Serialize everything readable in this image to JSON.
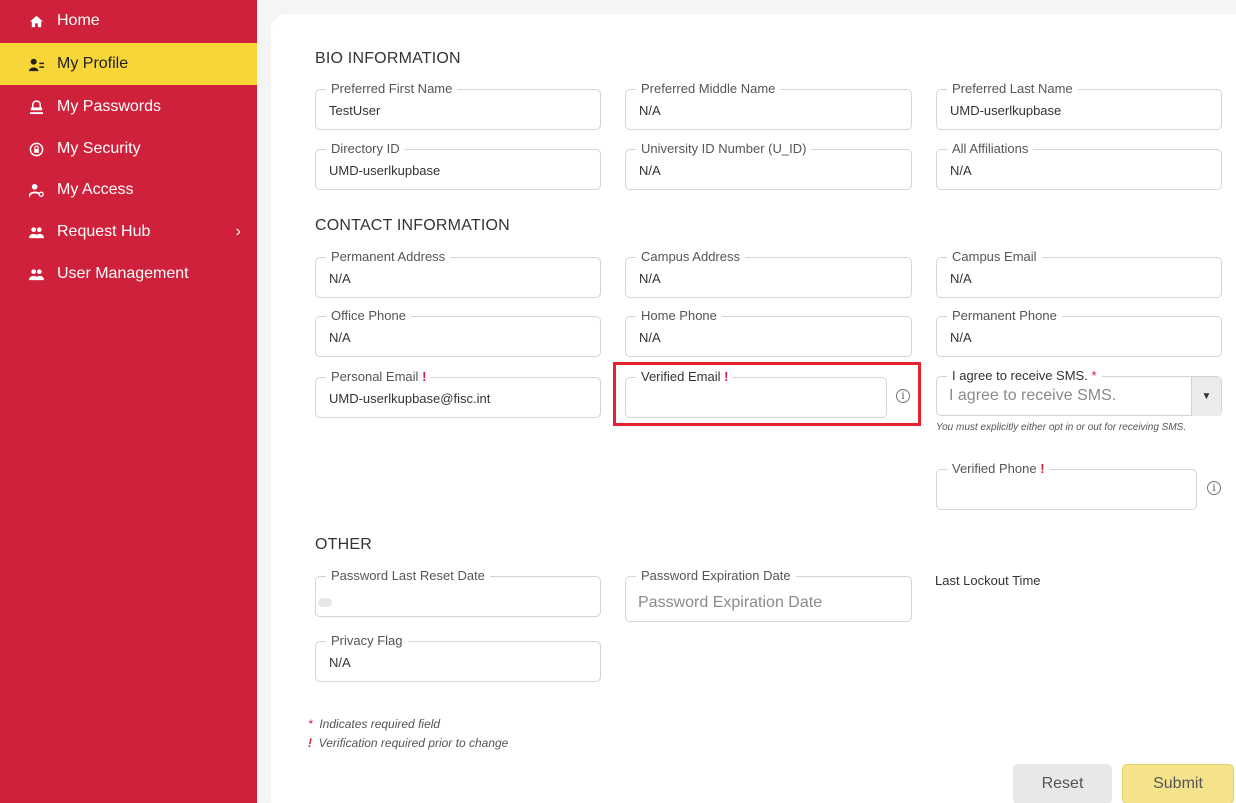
{
  "sidebar": {
    "items": [
      {
        "label": "Home",
        "icon": "home-icon"
      },
      {
        "label": "My Profile",
        "icon": "profile-icon",
        "active": true
      },
      {
        "label": "My Passwords",
        "icon": "password-icon"
      },
      {
        "label": "My Security",
        "icon": "security-icon"
      },
      {
        "label": "My Access",
        "icon": "access-icon"
      },
      {
        "label": "Request Hub",
        "icon": "users-icon"
      },
      {
        "label": "User Management",
        "icon": "users-icon"
      }
    ],
    "chevron": "›"
  },
  "sections": {
    "bio": "BIO INFORMATION",
    "contact": "CONTACT INFORMATION",
    "other": "OTHER"
  },
  "bio": {
    "first_name": {
      "label": "Preferred First Name",
      "value": "TestUser"
    },
    "middle_name": {
      "label": "Preferred Middle Name",
      "value": "N/A"
    },
    "last_name": {
      "label": "Preferred Last Name",
      "value": "UMD-userlkupbase"
    },
    "directory_id": {
      "label": "Directory ID",
      "value": "UMD-userlkupbase"
    },
    "uid": {
      "label": "University ID Number (U_ID)",
      "value": "N/A"
    },
    "affiliations": {
      "label": "All Affiliations",
      "value": "N/A"
    }
  },
  "contact": {
    "permanent_address": {
      "label": "Permanent Address",
      "value": "N/A"
    },
    "campus_address": {
      "label": "Campus Address",
      "value": "N/A"
    },
    "campus_email": {
      "label": "Campus Email",
      "value": "N/A"
    },
    "office_phone": {
      "label": "Office Phone",
      "value": "N/A"
    },
    "home_phone": {
      "label": "Home Phone",
      "value": "N/A"
    },
    "permanent_phone": {
      "label": "Permanent Phone",
      "value": "N/A"
    },
    "personal_email": {
      "label": "Personal Email",
      "value": "UMD-userlkupbase@fisc.int"
    },
    "verified_email": {
      "label": "Verified Email",
      "value": ""
    },
    "sms": {
      "label": "I agree to receive SMS.",
      "placeholder": "I agree to receive SMS."
    },
    "sms_hint": "You must explicitly either opt in or out for receiving SMS.",
    "verified_phone": {
      "label": "Verified Phone",
      "value": ""
    }
  },
  "other": {
    "password_reset": {
      "label": "Password Last Reset Date",
      "value": ""
    },
    "password_expiration": {
      "label": "Password Expiration Date",
      "placeholder": "Password Expiration Date"
    },
    "last_lockout": {
      "label": "Last Lockout Time"
    },
    "privacy_flag": {
      "label": "Privacy Flag",
      "value": "N/A"
    }
  },
  "marks": {
    "excl": "!",
    "star": "*",
    "info": "i",
    "caret": "▼"
  },
  "legend": {
    "required": "Indicates required field",
    "verification": "Verification required prior to change"
  },
  "buttons": {
    "reset": "Reset",
    "submit": "Submit"
  },
  "colors": {
    "brand_red": "#d0213c",
    "active_yellow": "#f7d63a",
    "highlight": "#e5222e"
  }
}
